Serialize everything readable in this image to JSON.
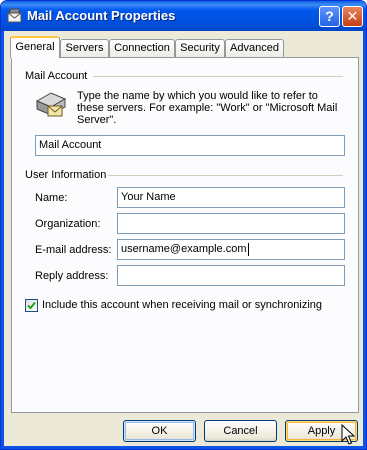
{
  "window": {
    "title": "Mail Account Properties",
    "help_label": "?",
    "close_label": "✕"
  },
  "tabs": [
    {
      "label": "General",
      "active": true
    },
    {
      "label": "Servers"
    },
    {
      "label": "Connection"
    },
    {
      "label": "Security"
    },
    {
      "label": "Advanced"
    }
  ],
  "mail_account": {
    "group_label": "Mail Account",
    "description": "Type the name by which you would like to refer to these servers.  For example: \"Work\" or \"Microsoft Mail Server\".",
    "account_name_value": "Mail Account",
    "icon": "mail-server-icon"
  },
  "user_info": {
    "group_label": "User Information",
    "name_label": "Name:",
    "name_value": "Your Name",
    "organization_label": "Organization:",
    "organization_value": "",
    "email_label": "E-mail address:",
    "email_value": "username@example.com",
    "reply_label": "Reply address:",
    "reply_value": ""
  },
  "include_checkbox": {
    "label": "Include this account when receiving mail or synchronizing",
    "checked": true
  },
  "buttons": {
    "ok": "OK",
    "cancel": "Cancel",
    "apply": "Apply"
  },
  "colors": {
    "titlebar": "#0058ee",
    "dialog_bg": "#ece9d8",
    "active_tab_accent": "#ffc83c"
  }
}
